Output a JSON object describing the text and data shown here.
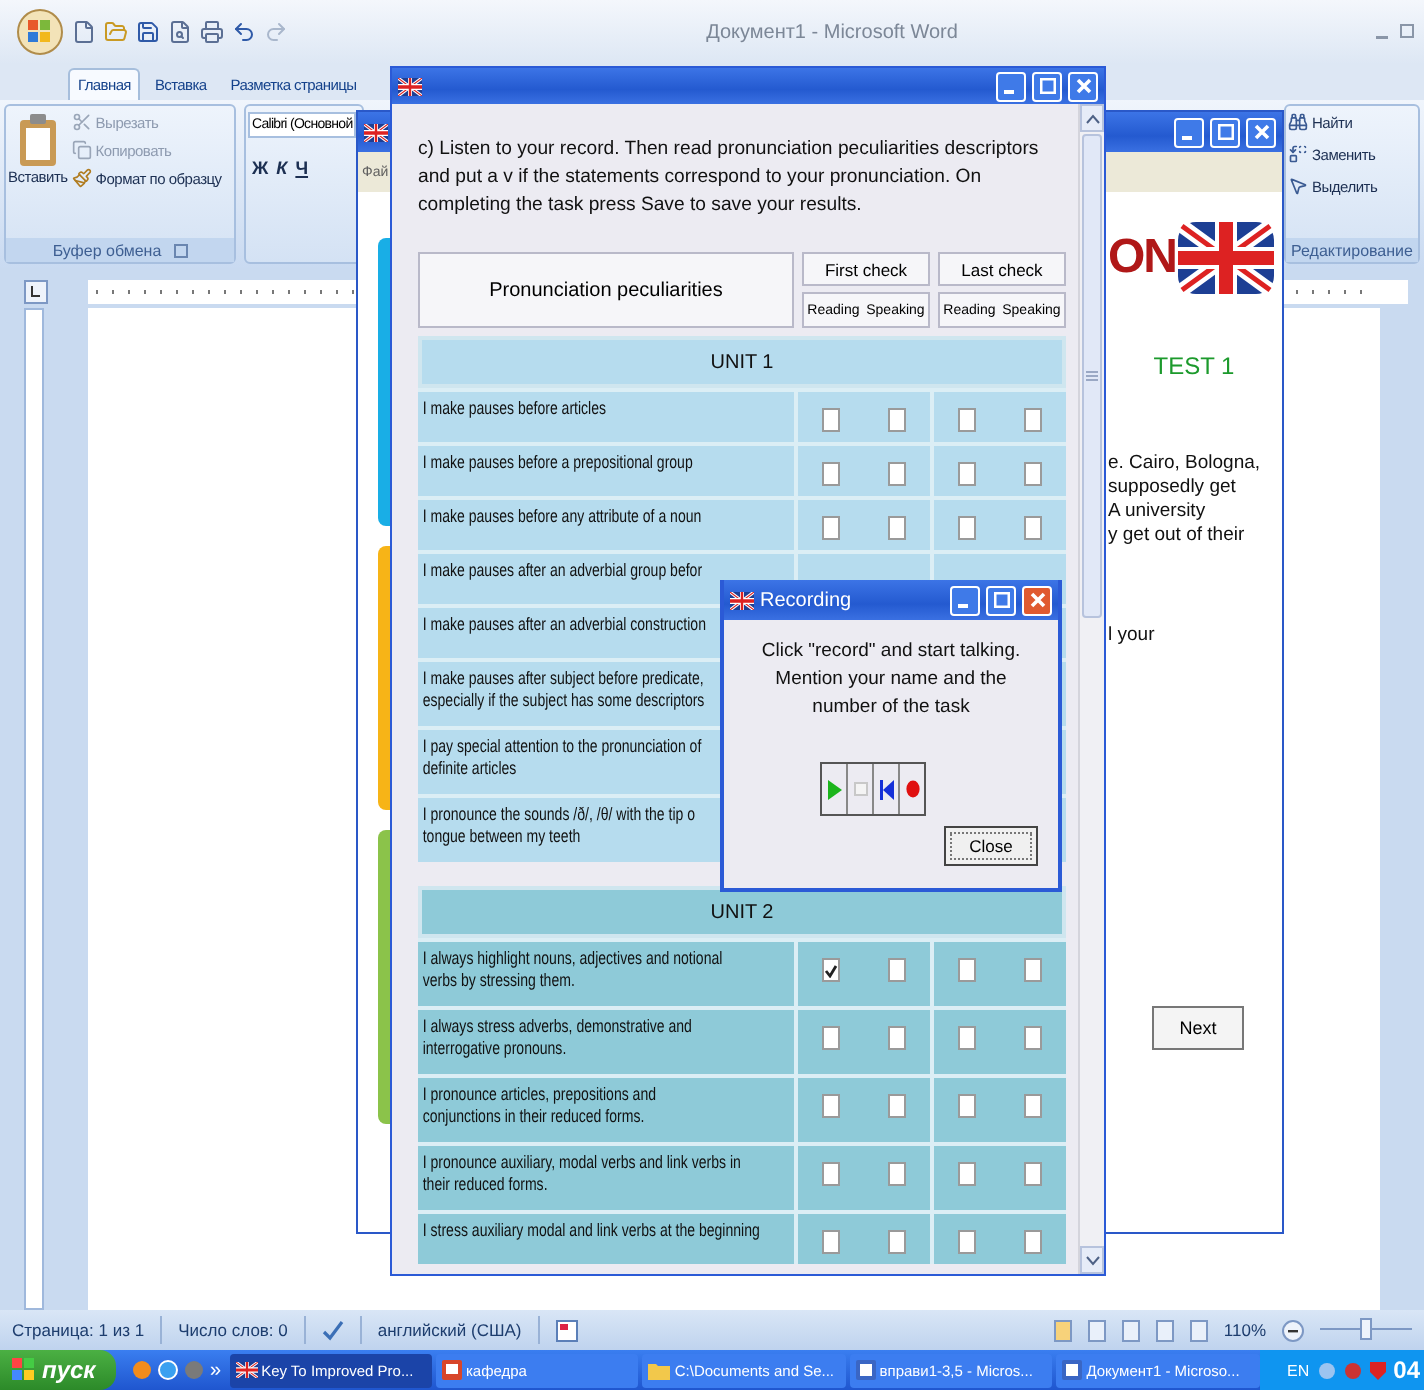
{
  "word": {
    "title": "Документ1 - Microsoft Word",
    "tabs": [
      {
        "label": "Главная",
        "selected": true
      },
      {
        "label": "Вставка",
        "selected": false
      },
      {
        "label": "Разметка страницы",
        "selected": false
      }
    ],
    "clipboard": {
      "paste": "Вставить",
      "items": [
        {
          "label": "Вырезать",
          "disabled": true,
          "kind": "cut"
        },
        {
          "label": "Копировать",
          "disabled": true,
          "kind": "copy"
        },
        {
          "label": "Формат по образцу",
          "disabled": false,
          "kind": "painter"
        }
      ],
      "group": "Буфер обмена"
    },
    "font": {
      "name": "Calibri (Основной",
      "styles": [
        "Ж",
        "К",
        "Ч"
      ]
    },
    "editing": {
      "items": [
        "Найти",
        "Заменить",
        "Выделить"
      ],
      "group": "Редактирование"
    },
    "status_bar": {
      "items": [
        "Страница: 1 из 1",
        "Число слов: 0"
      ],
      "language": "английский (США)",
      "zoom": "110%",
      "zoom_slider": {
        "level": 0.5
      }
    }
  },
  "taskbar": {
    "start": "пуск",
    "more": "»",
    "tasks": [
      {
        "label": "Key To Improved Pro...",
        "kind": "flag",
        "selected": true
      },
      {
        "label": "кафедра",
        "kind": "slides",
        "selected": false
      },
      {
        "label": "C:\\Documents and Se...",
        "kind": "folder",
        "selected": false
      },
      {
        "label": "вправи1-3,5 - Micros...",
        "kind": "document",
        "selected": false
      },
      {
        "label": "Документ1 - Microso...",
        "kind": "document",
        "selected": false
      }
    ],
    "language": "EN",
    "clock": "04"
  },
  "test_window": {
    "menu": "Фай",
    "sections": [
      {
        "color": "#19aee6"
      },
      {
        "color": "#f7b417"
      },
      {
        "color": "#8bc34a"
      }
    ],
    "logo_text": "ON",
    "heading": "TEST 1",
    "paragraph": [
      "e. Cairo, Bologna,",
      "supposedly get",
      "A university",
      "y get out of their"
    ],
    "fragment": "l your",
    "next": "Next"
  },
  "dialog": {
    "instruction": "c)  Listen to your record. Then read pronunciation peculiarities descriptors and put a v if the statements correspond to your pronunciation. On completing the task press Save to save your results.",
    "header": {
      "title": "Pronunciation peculiarities",
      "groups": [
        {
          "label": "First check",
          "columns": [
            "Reading",
            "Speaking"
          ]
        },
        {
          "label": "Last check",
          "columns": [
            "Reading",
            "Speaking"
          ]
        }
      ]
    },
    "units": [
      {
        "title": "UNIT 1",
        "kind": "light",
        "rows": [
          {
            "lines": [
              "I make pauses before articles"
            ],
            "checks": [
              {
                "checked": false
              },
              {
                "checked": false
              },
              {
                "checked": false
              },
              {
                "checked": false
              }
            ]
          },
          {
            "lines": [
              "I make pauses before a prepositional group"
            ],
            "checks": [
              {
                "checked": false
              },
              {
                "checked": false
              },
              {
                "checked": false
              },
              {
                "checked": false
              }
            ]
          },
          {
            "lines": [
              "I make pauses before any attribute of a noun"
            ],
            "checks": [
              {
                "checked": false
              },
              {
                "checked": false
              },
              {
                "checked": false
              },
              {
                "checked": false
              }
            ]
          },
          {
            "lines": [
              "I make pauses after an adverbial group befor"
            ]
          },
          {
            "lines": [
              "I make pauses after an adverbial construction"
            ]
          },
          {
            "lines": [
              "I make pauses after subject before predicate,",
              "especially if the subject has some descriptors"
            ]
          },
          {
            "lines": [
              "I pay special attention to the pronunciation of",
              "definite articles"
            ]
          },
          {
            "lines": [
              "I pronounce the sounds /ð/, /θ/  with the tip o",
              "tongue between my teeth"
            ]
          }
        ]
      },
      {
        "title": "UNIT 2",
        "kind": "dark",
        "rows": [
          {
            "lines": [
              "I always highlight nouns, adjectives and notional",
              "verbs by stressing them."
            ],
            "checks": [
              {
                "checked": true
              },
              {
                "checked": false
              },
              {
                "checked": false
              },
              {
                "checked": false
              }
            ]
          },
          {
            "lines": [
              "I always stress adverbs, demonstrative and",
              "interrogative pronouns."
            ],
            "checks": [
              {
                "checked": false
              },
              {
                "checked": false
              },
              {
                "checked": false
              },
              {
                "checked": false
              }
            ]
          },
          {
            "lines": [
              "I pronounce articles, prepositions and",
              "conjunctions in their reduced forms."
            ],
            "checks": [
              {
                "checked": false
              },
              {
                "checked": false
              },
              {
                "checked": false
              },
              {
                "checked": false
              }
            ]
          },
          {
            "lines": [
              "I pronounce auxiliary, modal verbs and link verbs in",
              "their reduced forms."
            ],
            "checks": [
              {
                "checked": false
              },
              {
                "checked": false
              },
              {
                "checked": false
              },
              {
                "checked": false
              }
            ]
          },
          {
            "lines": [
              "I stress auxiliary modal and link verbs at the beginning"
            ],
            "checks": [
              {
                "checked": false
              },
              {
                "checked": false
              },
              {
                "checked": false
              },
              {
                "checked": false
              }
            ]
          }
        ]
      }
    ]
  },
  "recording": {
    "title": "Recording",
    "message": [
      "Click \"record\" and start talking.",
      "Mention your name and the",
      "number of the task"
    ],
    "controls": [
      {
        "kind": "play",
        "disabled": false
      },
      {
        "kind": "stop",
        "disabled": true
      },
      {
        "kind": "rewind",
        "disabled": false
      },
      {
        "kind": "record",
        "disabled": false
      }
    ],
    "close": "Close"
  }
}
